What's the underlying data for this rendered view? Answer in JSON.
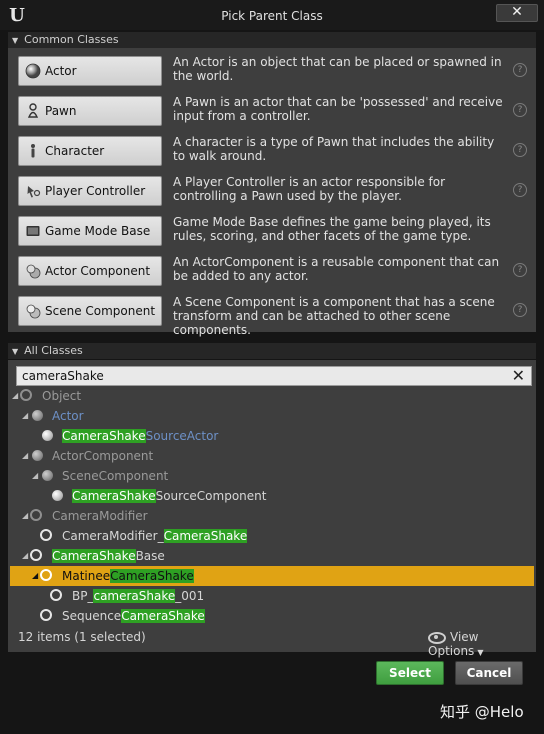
{
  "window": {
    "title": "Pick Parent Class",
    "close_label": "✕"
  },
  "common_classes": {
    "header": "Common Classes",
    "items": [
      {
        "label": "Actor",
        "description": "An Actor is an object that can be placed or spawned in the world.",
        "icon": "actor-sphere-icon"
      },
      {
        "label": "Pawn",
        "description": "A Pawn is an actor that can be 'possessed' and receive input from a controller.",
        "icon": "pawn-icon"
      },
      {
        "label": "Character",
        "description": "A character is a type of Pawn that includes the ability to walk around.",
        "icon": "character-icon"
      },
      {
        "label": "Player Controller",
        "description": "A Player Controller is an actor responsible for controlling a Pawn used by the player.",
        "icon": "player-controller-icon"
      },
      {
        "label": "Game Mode Base",
        "description": "Game Mode Base defines the game being played, its rules, scoring, and other facets of the game type.",
        "icon": "game-mode-icon"
      },
      {
        "label": "Actor Component",
        "description": "An ActorComponent is a reusable component that can be added to any actor.",
        "icon": "actor-component-icon"
      },
      {
        "label": "Scene Component",
        "description": "A Scene Component is a component that has a scene transform and can be attached to other scene components.",
        "icon": "scene-component-icon"
      }
    ],
    "help_glyph": "?"
  },
  "all_classes": {
    "header": "All Classes",
    "search": {
      "value": "cameraShake",
      "clear_glyph": "✕"
    },
    "tree": [
      {
        "pre": "Object",
        "hl": "",
        "post": ""
      },
      {
        "pre": "Actor",
        "hl": "",
        "post": ""
      },
      {
        "pre": "",
        "hl": "CameraShake",
        "post": "SourceActor"
      },
      {
        "pre": "ActorComponent",
        "hl": "",
        "post": ""
      },
      {
        "pre": "SceneComponent",
        "hl": "",
        "post": ""
      },
      {
        "pre": "",
        "hl": "CameraShake",
        "post": "SourceComponent"
      },
      {
        "pre": "CameraModifier",
        "hl": "",
        "post": ""
      },
      {
        "pre": "CameraModifier_",
        "hl": "CameraShake",
        "post": ""
      },
      {
        "pre": "",
        "hl": "CameraShake",
        "post": "Base"
      },
      {
        "pre": "Matinee",
        "hl": "CameraShake",
        "post": ""
      },
      {
        "pre": "BP_",
        "hl": "cameraShake",
        "post": "_001"
      },
      {
        "pre": "Sequence",
        "hl": "CameraShake",
        "post": ""
      }
    ],
    "status": "12 items (1 selected)",
    "view_options": "View Options"
  },
  "actions": {
    "select": "Select",
    "cancel": "Cancel"
  },
  "watermark": "知乎 @Helo",
  "colors": {
    "highlight": "#2ea023",
    "selection": "#e0a314",
    "select_button": "#4caf50"
  }
}
